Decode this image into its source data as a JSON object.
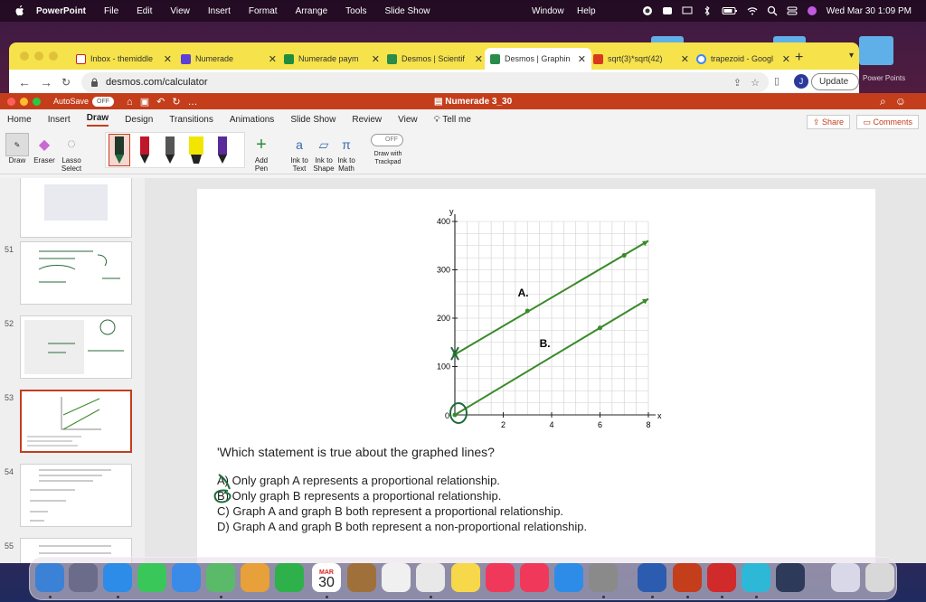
{
  "menubar": {
    "app": "PowerPoint",
    "items": [
      "File",
      "Edit",
      "View",
      "Insert",
      "Format",
      "Arrange",
      "Tools",
      "Slide Show"
    ],
    "right_items": [
      "Window",
      "Help"
    ],
    "clock": "Wed Mar 30  1:09 PM"
  },
  "browser": {
    "tabs": [
      {
        "label": "Inbox - themiddle",
        "fav_color": "#c5221f",
        "icon": "gmail-icon"
      },
      {
        "label": "Numerade",
        "fav_color": "#5b3fd6",
        "icon": "numerade-icon"
      },
      {
        "label": "Numerade paym",
        "fav_color": "#1e8e3e",
        "icon": "sheets-icon"
      },
      {
        "label": "Desmos | Scientif",
        "fav_color": "#2a8c4a",
        "icon": "desmos-icon"
      },
      {
        "label": "Desmos | Graphin",
        "fav_color": "#2a8c4a",
        "icon": "desmos-icon",
        "active": true
      },
      {
        "label": "sqrt(3)*sqrt(42)",
        "fav_color": "#d9381e",
        "icon": "symbolab-icon"
      },
      {
        "label": "trapezoid - Googl",
        "fav_color": "#4285f4",
        "icon": "google-icon"
      }
    ],
    "url": "desmos.com/calculator",
    "profile_initial": "J",
    "update_label": "Update"
  },
  "desktop": {
    "folder_label": "Power Points"
  },
  "powerpoint": {
    "autosave_label": "AutoSave",
    "autosave_state": "OFF",
    "doc_title": "Numerade 3_30",
    "ribbon_tabs": [
      "Home",
      "Insert",
      "Draw",
      "Design",
      "Transitions",
      "Animations",
      "Slide Show",
      "Review",
      "View",
      "Tell me"
    ],
    "active_tab": "Draw",
    "share_label": "Share",
    "comments_label": "Comments",
    "tools": {
      "draw": "Draw",
      "eraser": "Eraser",
      "lasso": "Lasso Select",
      "add_pen": "Add Pen",
      "ink_text": "Ink to Text",
      "ink_shape": "Ink to Shape",
      "ink_math": "Ink to Math",
      "trackpad_state": "OFF",
      "trackpad_label": "Draw with Trackpad"
    },
    "pen_colors": [
      "#1f6b3a",
      "#c0182a",
      "#555555",
      "#f2e600",
      "#5a2a9a"
    ],
    "slide_numbers": [
      "51",
      "52",
      "53",
      "54",
      "55"
    ],
    "selected_slide": "53"
  },
  "slide": {
    "question": "'Which statement is true about the graphed lines?",
    "options": [
      {
        "letter": "A)",
        "text": "Only graph A represents a proportional relationship."
      },
      {
        "letter": "B)",
        "text": "Only graph B represents a proportional relationship."
      },
      {
        "letter": "C)",
        "text": "Graph A and graph B both represent a proportional relationship."
      },
      {
        "letter": "D)",
        "text": "Graph A and graph B both represent a non-proportional relationship."
      }
    ],
    "graph": {
      "y_axis_label": "y",
      "x_axis_label": "x",
      "origin_label": "0",
      "y_ticks": [
        "100",
        "200",
        "300",
        "400"
      ],
      "x_ticks": [
        "2",
        "4",
        "6",
        "8"
      ],
      "line_a_label": "A.",
      "line_b_label": "B.",
      "line_color": "#3a8a2a",
      "annotation_color": "#1f6b3a"
    }
  },
  "chart_data": {
    "type": "line",
    "title": "",
    "xlabel": "x",
    "ylabel": "y",
    "xlim": [
      0,
      8
    ],
    "ylim": [
      0,
      400
    ],
    "x_ticks": [
      2,
      4,
      6,
      8
    ],
    "y_ticks": [
      100,
      200,
      300,
      400
    ],
    "grid": true,
    "series": [
      {
        "name": "A.",
        "x": [
          0,
          3,
          7,
          8
        ],
        "y": [
          125,
          215,
          330,
          360
        ],
        "points": [
          [
            0,
            125
          ],
          [
            3,
            215
          ],
          [
            7,
            330
          ]
        ]
      },
      {
        "name": "B.",
        "x": [
          0,
          6,
          8
        ],
        "y": [
          0,
          180,
          240
        ],
        "points": [
          [
            0,
            0
          ],
          [
            6,
            180
          ]
        ]
      }
    ]
  },
  "dock": {
    "apps": [
      {
        "name": "finder-icon",
        "color": "#3b82d6"
      },
      {
        "name": "launchpad-icon",
        "color": "#6b6b8a"
      },
      {
        "name": "safari-icon",
        "color": "#2d8ce8"
      },
      {
        "name": "messages-icon",
        "color": "#3ac75a"
      },
      {
        "name": "mail-icon",
        "color": "#3a8ae8"
      },
      {
        "name": "maps-icon",
        "color": "#5aba6a"
      },
      {
        "name": "photos-icon",
        "color": "#e8a03a"
      },
      {
        "name": "facetime-icon",
        "color": "#2eb14a"
      },
      {
        "name": "calendar-icon",
        "color": "#ffffff",
        "text_top": "MAR",
        "text": "30"
      },
      {
        "name": "notes-brown-icon",
        "color": "#a0703a"
      },
      {
        "name": "reminders-icon",
        "color": "#f0f0f0"
      },
      {
        "name": "chrome-icon",
        "color": "#e8e8e8"
      },
      {
        "name": "notes-icon",
        "color": "#f7d84a"
      },
      {
        "name": "music-icon",
        "color": "#f0395a"
      },
      {
        "name": "news-icon",
        "color": "#f0395a"
      },
      {
        "name": "app-store-icon",
        "color": "#2d8ce8"
      },
      {
        "name": "system-preferences-icon",
        "color": "#8a8a8a"
      },
      {
        "name": "word-icon",
        "color": "#2b5cb0"
      },
      {
        "name": "powerpoint-icon",
        "color": "#c43e1c"
      },
      {
        "name": "mail-red-icon",
        "color": "#d02a2a"
      },
      {
        "name": "w-app-icon",
        "color": "#2eb8d8"
      },
      {
        "name": "screen-capture-icon",
        "color": "#2d3a5a"
      },
      {
        "name": "downloads-icon",
        "color": "#d8d8e8"
      },
      {
        "name": "trash-icon",
        "color": "#d8d8d8"
      }
    ],
    "calendar_month": "MAR",
    "calendar_day": "30"
  }
}
